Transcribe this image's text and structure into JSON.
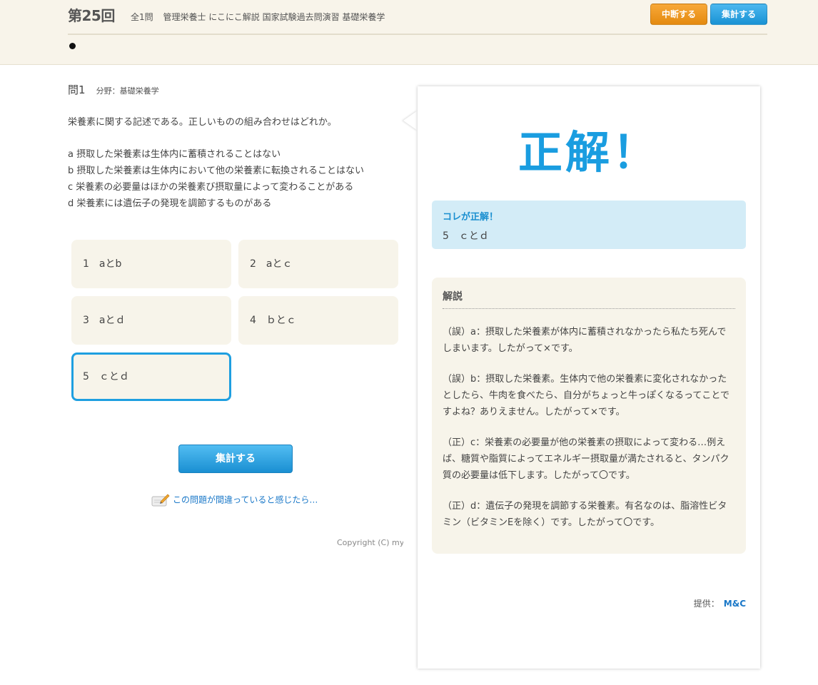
{
  "header": {
    "round": "第25回",
    "total": "全1問",
    "subject_title": "管理栄養士 にこにこ解説 国家試験過去問演習 基礎栄養学",
    "pause_button": "中断する",
    "tally_button": "集計する"
  },
  "question": {
    "number": "問1",
    "field": "分野：基礎栄養学",
    "text": "栄養素に関する記述である。正しいものの組み合わせはどれか。",
    "statements": [
      "a 摂取した栄養素は生体内に蓄積されることはない",
      "b 摂取した栄養素は生体内において他の栄養素に転換されることはない",
      "c 栄養素の必要量はほかの栄養素び摂取量によって変わることがある",
      "d 栄養素には遺伝子の発現を調節するものがある"
    ],
    "choices": [
      "1　aとb",
      "2　aとｃ",
      "3　aとｄ",
      "4　ｂとｃ",
      "5　ｃとｄ"
    ],
    "selected_choice": "5"
  },
  "submit_button": "集計する",
  "report_link": "この問題が間違っていると感じたら…",
  "copyright": "Copyright (C) my",
  "result": {
    "heading": "正解！",
    "answer_label": "コレが正解！",
    "answer_value": "5　ｃとｄ",
    "explanation_title": "解説",
    "explanations": [
      "（誤）a：摂取した栄養素が体内に蓄積されなかったら私たち死んでしまいます。したがって×です。",
      "（誤）b：摂取した栄養素。生体内で他の栄養素に変化されなかったとしたら、牛肉を食べたら、自分がちょっと牛っぽくなるってことですよね？ありえません。したがって×です。",
      "（正）c：栄養素の必要量が他の栄養素の摂取によって変わる…例えば、糖質や脂質によってエネルギー摂取量が満たされると、タンパク質の必要量は低下します。したがって〇です。",
      "（正）d：遺伝子の発現を調節する栄養素。有名なのは、脂溶性ビタミン（ビタミンEを除く）です。したがって〇です。"
    ],
    "provider_label": "提供：",
    "provider_name": "M&C"
  },
  "colors": {
    "accent_blue": "#1a9de0",
    "accent_orange": "#e48a10",
    "header_bg": "#f8f4ea",
    "choice_bg": "#f7f4ea",
    "answer_bg": "#d3ecf7"
  }
}
